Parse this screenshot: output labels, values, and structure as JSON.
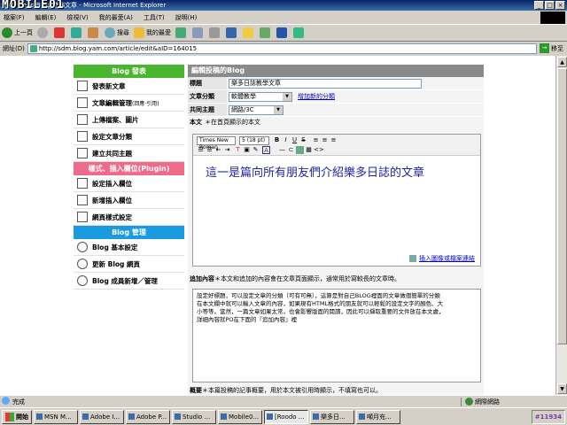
{
  "window": {
    "title": "[Roodo Blog]發佈文章 - Microsoft Internet Explorer",
    "watermark": "MOBILE01"
  },
  "menu": [
    "檔案(F)",
    "編輯(E)",
    "檢視(V)",
    "我的最愛(A)",
    "工具(T)",
    "說明(H)"
  ],
  "toolbar": {
    "back": "上一頁",
    "search": "搜尋",
    "favorites": "我的最愛"
  },
  "address": {
    "label": "網址(D)",
    "url": "http://sdm.blog.yam.com/article/edit&aID=164015",
    "go": "移至"
  },
  "sidebar": {
    "sections": [
      {
        "title": "Blog 發表",
        "color": "#49b62e",
        "items": [
          {
            "label": "發表新文章",
            "note": ""
          },
          {
            "label": "文章編輯管理",
            "note": "(回應‧引用)"
          },
          {
            "label": "上傳檔案、圖片",
            "note": ""
          },
          {
            "label": "設定文章分類",
            "note": ""
          },
          {
            "label": "建立共同主題",
            "note": ""
          }
        ]
      },
      {
        "title": "樣式、插入欄位(Plugin)",
        "color": "#f06a8a",
        "items": [
          {
            "label": "設定插入欄位",
            "note": ""
          },
          {
            "label": "新增插入欄位",
            "note": ""
          },
          {
            "label": "網頁樣式設定",
            "note": ""
          }
        ]
      },
      {
        "title": "Blog 管理",
        "color": "#1a9be0",
        "items": [
          {
            "label": "Blog 基本設定",
            "note": ""
          },
          {
            "label": "更新 Blog 網頁",
            "note": ""
          },
          {
            "label": "Blog 成員新增／管理",
            "note": ""
          }
        ]
      }
    ]
  },
  "form": {
    "heading": "編輯投稿的Blog",
    "title_label": "標題",
    "title_value": "樂多日誌教學文章",
    "category_label": "文章分類",
    "category_value": "軟體教學",
    "add_category_link": "增加新的分類",
    "theme_label": "共同主題",
    "theme_value": "網路/3C",
    "body_label": "本文",
    "body_note": "＊在首頁顯示的本文",
    "font_name": "Times New Roman",
    "font_size": "5 (18 pt)",
    "body_text": "這一是篇向所有朋友們介紹樂多日誌的文章",
    "insert_link": "插入圖像或檔案連結",
    "additional_label": "追加內容",
    "additional_note": "＊本文和追加的內容會在文章頁面顯示，通常用於寫較長的文章時。",
    "additional_lines": [
      "設定好標題，可以設定文章的分類（可有可無），這算是對自己BLOG裡面的文章做個簡單的分類",
      "在本文欄中就可以輸入文章的內容，如果現有HTML格式的朋友就可以輕鬆的設定文字的顏色、大",
      "小等等。當然，一篇文章如果太常，也會影響版面的閱讀，因此可以擷取重要的文件放在本文處，",
      "詳細內容就PO在下面的『追加內容』裡"
    ],
    "summary_label": "概要",
    "summary_note": "＊本篇投稿的記事概要，用於本文被引用時顯示，不填寫也可以。"
  },
  "status": {
    "left": "完成",
    "zone": "網際網路"
  },
  "taskbar": {
    "start": "開始",
    "items": [
      "MSN M...",
      "Adobe I...",
      "Adobe P...",
      "Studio ...",
      "Mobile0...",
      "[Roodo ...",
      "樂多日...",
      "噸月充..."
    ],
    "active_index": 5,
    "clock": "#11934"
  }
}
